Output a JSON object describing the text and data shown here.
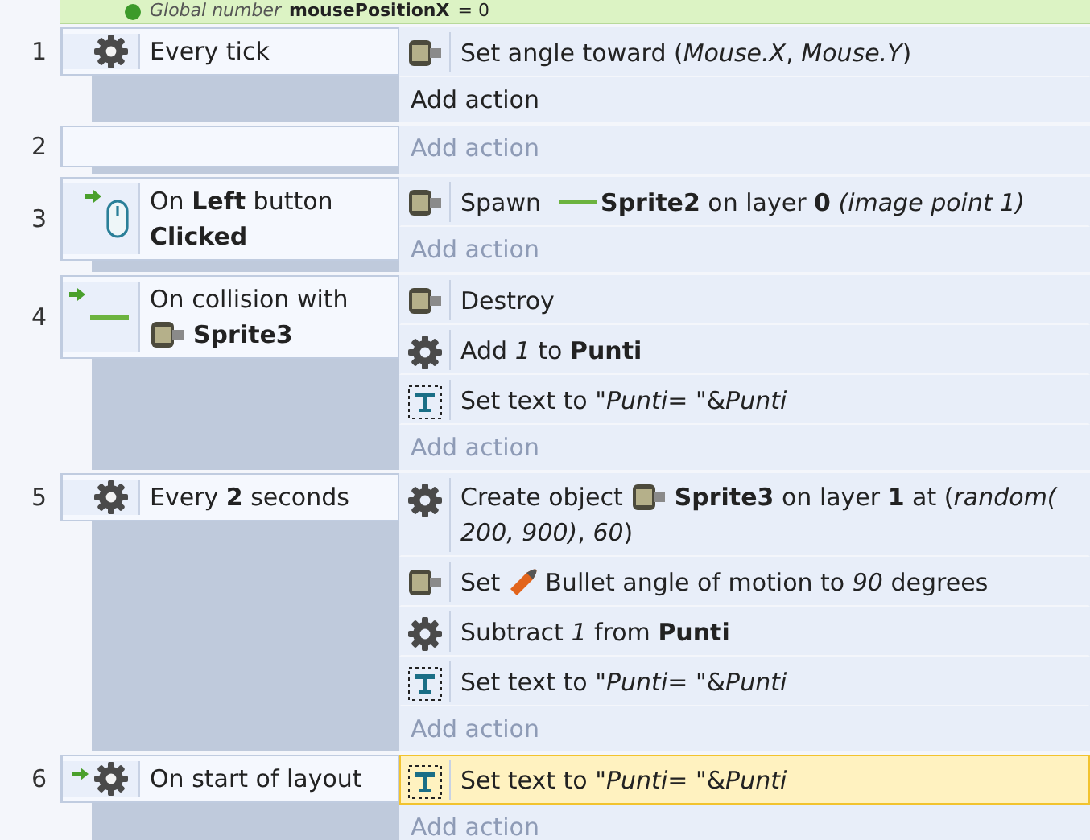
{
  "global_variable": {
    "label": "Global number",
    "name": "mousePositionX",
    "value": "= 0"
  },
  "events": [
    {
      "number": "1",
      "conditions": [
        {
          "kind": "gear",
          "trigger": false,
          "parts": [
            {
              "kind": "text",
              "s": "Every tick"
            }
          ]
        }
      ],
      "actions": [
        {
          "kind": "sprite",
          "selected": false,
          "parts": [
            {
              "kind": "text",
              "s": "Set angle toward (*Mouse.X*, *Mouse.Y*)"
            }
          ]
        }
      ],
      "add_action": {
        "label": "Add action",
        "highlighted": true
      }
    },
    {
      "number": "2",
      "add_action": {
        "label": "Add action",
        "highlighted": false
      }
    },
    {
      "number": "3",
      "conditions": [
        {
          "kind": "mouse",
          "trigger": true,
          "parts": [
            {
              "kind": "text",
              "s": "On **Left** button"
            },
            {
              "kind": "text",
              "s": "**Clicked**"
            }
          ]
        }
      ],
      "actions": [
        {
          "kind": "sprite",
          "selected": false,
          "parts": [
            {
              "kind": "text",
              "s": "Spawn"
            },
            {
              "kind": "line"
            },
            {
              "kind": "text",
              "s": "**Sprite2** on layer **0** *(image point 1)*"
            }
          ]
        }
      ],
      "add_action": {
        "label": "Add action",
        "highlighted": false
      }
    },
    {
      "number": "4",
      "conditions": [
        {
          "kind": "line",
          "trigger": true,
          "parts": [
            {
              "kind": "text",
              "s": "On collision with"
            },
            {
              "kind": "sprite"
            },
            {
              "kind": "text",
              "s": "**Sprite3**"
            }
          ]
        }
      ],
      "actions": [
        {
          "kind": "sprite",
          "selected": false,
          "parts": [
            {
              "kind": "text",
              "s": "Destroy"
            }
          ]
        },
        {
          "kind": "gear",
          "selected": false,
          "parts": [
            {
              "kind": "text",
              "s": "Add *1* to **Punti**"
            }
          ]
        },
        {
          "kind": "text",
          "selected": false,
          "parts": [
            {
              "kind": "text",
              "s": "Set text to \"*Punti*= \"&*Punti*"
            }
          ]
        }
      ],
      "add_action": {
        "label": "Add action",
        "highlighted": false
      }
    },
    {
      "number": "5",
      "conditions": [
        {
          "kind": "gear",
          "trigger": false,
          "parts": [
            {
              "kind": "text",
              "s": "Every **2** seconds"
            }
          ]
        }
      ],
      "actions": [
        {
          "kind": "gear",
          "selected": false,
          "parts": [
            {
              "kind": "text",
              "s": "Create object"
            },
            {
              "kind": "sprite"
            },
            {
              "kind": "text",
              "s": "**Sprite3** on layer **1** at (*random(*"
            },
            {
              "kind": "text",
              "s": "*200, 900)*, *60*)"
            }
          ]
        },
        {
          "kind": "sprite",
          "selected": false,
          "parts": [
            {
              "kind": "text",
              "s": "Set"
            },
            {
              "kind": "bullet"
            },
            {
              "kind": "text",
              "s": "Bullet angle of motion to *90* degrees"
            }
          ]
        },
        {
          "kind": "gear",
          "selected": false,
          "parts": [
            {
              "kind": "text",
              "s": "Subtract *1* from **Punti**"
            }
          ]
        },
        {
          "kind": "text",
          "selected": false,
          "parts": [
            {
              "kind": "text",
              "s": "Set text to \"*Punti*= \"&*Punti*"
            }
          ]
        }
      ],
      "add_action": {
        "label": "Add action",
        "highlighted": false
      }
    },
    {
      "number": "6",
      "conditions": [
        {
          "kind": "gear",
          "trigger": true,
          "parts": [
            {
              "kind": "text",
              "s": "On start of layout"
            }
          ]
        }
      ],
      "actions": [
        {
          "kind": "text",
          "selected": true,
          "parts": [
            {
              "kind": "text",
              "s": "Set text to \"*Punti*= \"&*Punti*"
            }
          ]
        }
      ],
      "add_action": {
        "label": "Add action",
        "highlighted": false
      }
    }
  ]
}
